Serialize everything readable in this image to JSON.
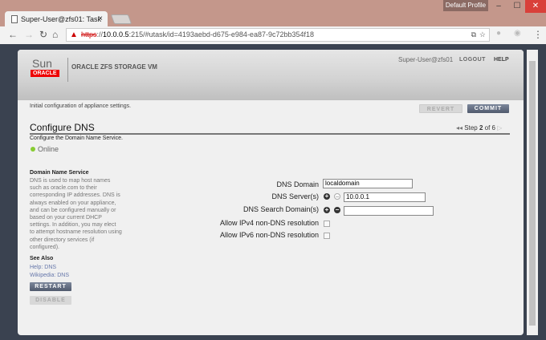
{
  "browser": {
    "profile": "Default Profile",
    "tab_title": "Super-User@zfs01: Task",
    "url_scheme": "https",
    "url_host": "10.0.0.5",
    "url_rest": ":215/#utask/id=4193aebd-d675-e984-ea87-9c72bb354f18"
  },
  "header": {
    "sun": "Sun",
    "oracle": "ORACLE",
    "product": "ORACLE ZFS STORAGE VM",
    "user": "Super-User@zfs01",
    "logout": "LOGOUT",
    "help": "HELP"
  },
  "main": {
    "intro": "Initial configuration of appliance settings.",
    "revert": "REVERT",
    "commit": "COMMIT",
    "title": "Configure DNS",
    "step_prefix": "Step",
    "step_num": "2",
    "step_suffix": "of 6",
    "description": "Configure the Domain Name Service.",
    "status": "Online"
  },
  "sidebar": {
    "heading": "Domain Name Service",
    "text": "DNS is used to map host names such as oracle.com to their corresponding IP addresses. DNS is always enabled on your appliance, and can be configured manually or based on your current DHCP settings. In addition, you may elect to attempt hostname resolution using other directory services (if configured).",
    "see_also": "See Also",
    "help_link": "Help: DNS",
    "wiki_link": "Wikipedia: DNS",
    "restart": "RESTART",
    "disable": "DISABLE"
  },
  "form": {
    "domain_label": "DNS Domain",
    "domain_value": "localdomain",
    "servers_label": "DNS Server(s)",
    "server_value": "10.0.0.1",
    "search_label": "DNS Search Domain(s)",
    "search_value": "",
    "ipv4_label": "Allow IPv4 non-DNS resolution",
    "ipv6_label": "Allow IPv6 non-DNS resolution"
  }
}
